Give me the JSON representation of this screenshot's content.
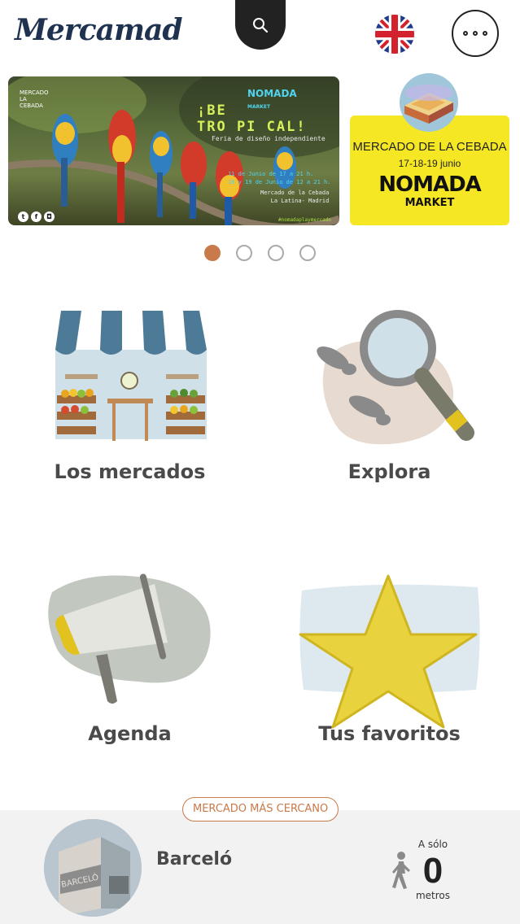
{
  "app": {
    "logo_text": "Mercamad"
  },
  "header": {
    "search_icon": "search-icon",
    "language_flag": "uk-flag-icon",
    "more_icon": "more-icon"
  },
  "carousel": {
    "slide1": {
      "brand": "MERCADO LA CEBADA",
      "nomada": "NOMADA",
      "market": "MARKET",
      "title_line1": "¡BE",
      "title_line2": "TRO PI CAL!",
      "subtitle": "Feria de diseño independiente",
      "dates_line1": "11 de Junio de 17 a 21 h.",
      "dates_line2": "18 y 19 de Junio de 12 a 21 h.",
      "place_line1": "Mercado de la Cebada",
      "place_line2": "La Latina- Madrid",
      "hashtag": "#nomadaplaymercado"
    },
    "slide2": {
      "title": "MERCADO DE LA CEBADA",
      "dates": "17-18-19 junio",
      "nomada": "NOMADA",
      "market": "MARKET"
    },
    "pages": 4,
    "active_page": 1
  },
  "tiles": [
    {
      "label": "Los mercados",
      "icon": "market-stall-icon"
    },
    {
      "label": "Explora",
      "icon": "magnifier-footprints-icon"
    },
    {
      "label": "Agenda",
      "icon": "megaphone-icon"
    },
    {
      "label": "Tus favoritos",
      "icon": "star-icon"
    }
  ],
  "nearest": {
    "badge": "MERCADO MÁS CERCANO",
    "market_name": "Barceló",
    "photo_sign": "BARCELÓ",
    "distance_prefix": "A sólo",
    "distance_value": "0",
    "distance_unit": "metros"
  },
  "colors": {
    "accent": "#c97a4a",
    "dark": "#222222",
    "text": "#4a4a4a",
    "logo": "#1f3350"
  }
}
